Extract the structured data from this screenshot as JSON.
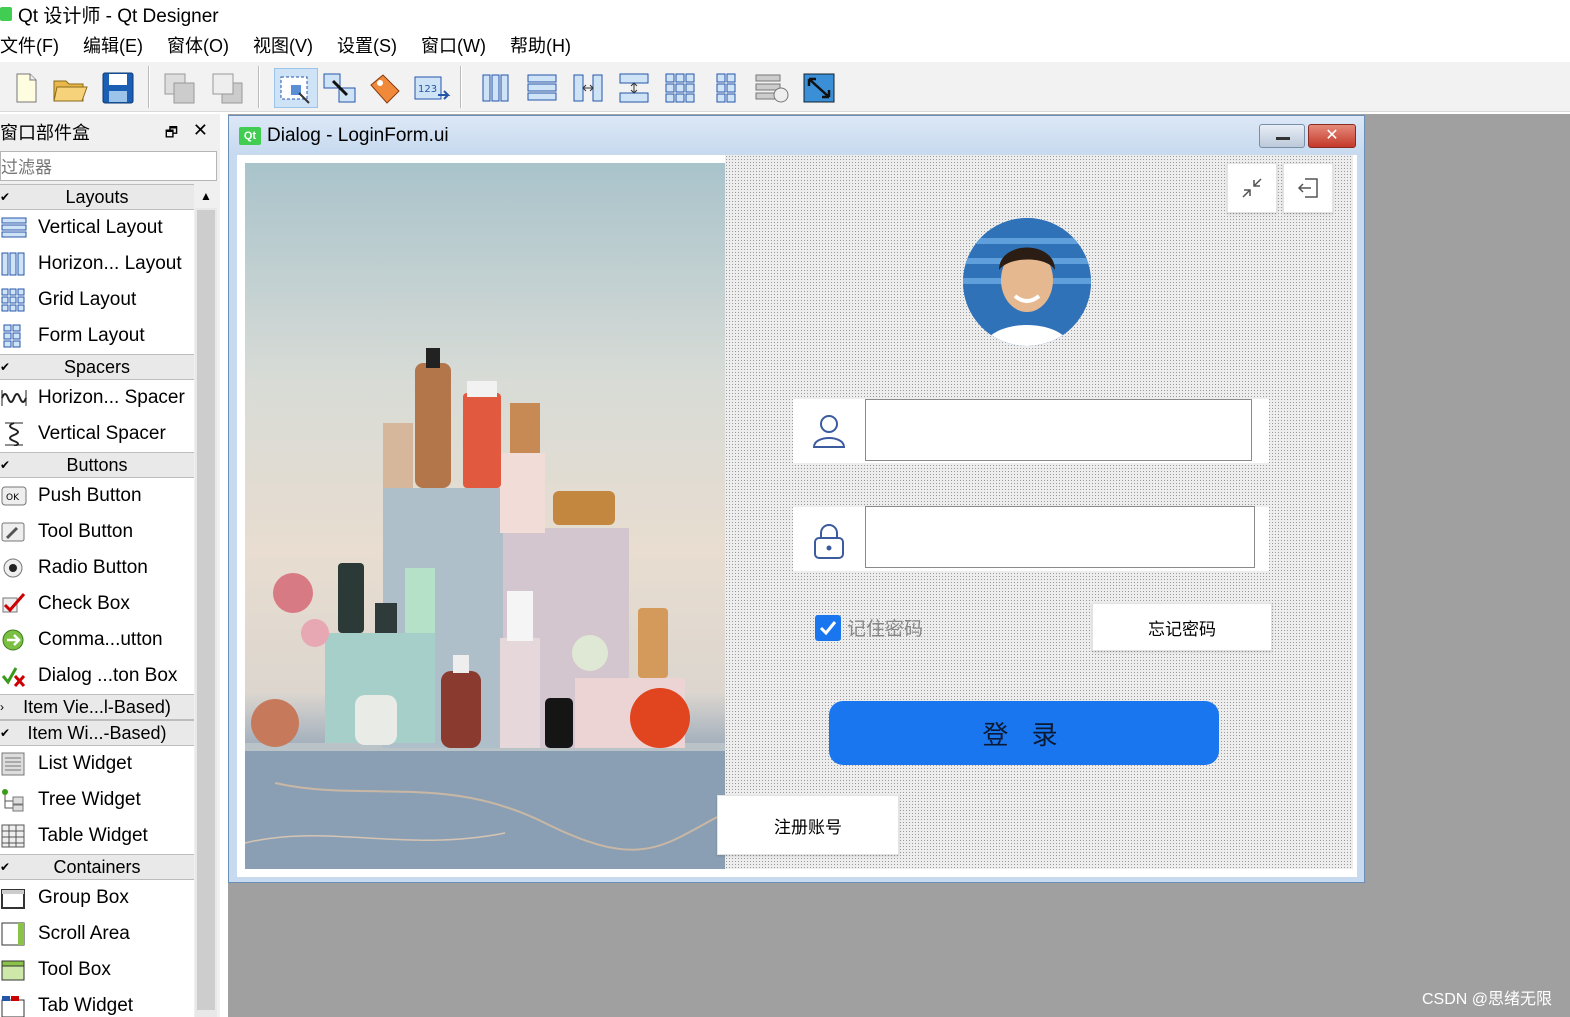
{
  "app": {
    "window_title": "Qt 设计师 - Qt Designer"
  },
  "menubar": {
    "items": [
      "文件(F)",
      "编辑(E)",
      "窗体(O)",
      "视图(V)",
      "设置(S)",
      "窗口(W)",
      "帮助(H)"
    ]
  },
  "toolbar": {
    "buttons": [
      {
        "name": "new-form-icon"
      },
      {
        "name": "open-form-icon"
      },
      {
        "name": "save-form-icon"
      },
      {
        "name": "send-to-back-icon"
      },
      {
        "name": "bring-to-front-icon"
      },
      {
        "name": "edit-widgets-icon"
      },
      {
        "name": "edit-signals-slots-icon"
      },
      {
        "name": "edit-buddies-icon"
      },
      {
        "name": "edit-tab-order-icon"
      },
      {
        "name": "layout-horizontal-icon"
      },
      {
        "name": "layout-vertical-icon"
      },
      {
        "name": "layout-h-splitter-icon"
      },
      {
        "name": "layout-v-splitter-icon"
      },
      {
        "name": "layout-grid-icon"
      },
      {
        "name": "layout-form-icon"
      },
      {
        "name": "break-layout-icon"
      },
      {
        "name": "adjust-size-icon"
      }
    ]
  },
  "widget_box": {
    "title": "窗口部件盒",
    "filter_placeholder": "过滤器",
    "categories": [
      {
        "label": "Layouts",
        "items": [
          "Vertical Layout",
          "Horizon... Layout",
          "Grid Layout",
          "Form Layout"
        ]
      },
      {
        "label": "Spacers",
        "items": [
          "Horizon... Spacer",
          "Vertical Spacer"
        ]
      },
      {
        "label": "Buttons",
        "items": [
          "Push Button",
          "Tool Button",
          "Radio Button",
          "Check Box",
          "Comma...utton",
          "Dialog ...ton Box"
        ]
      },
      {
        "label": "Item Vie...l-Based)",
        "items": []
      },
      {
        "label": "Item Wi...-Based)",
        "items": [
          "List Widget",
          "Tree Widget",
          "Table Widget"
        ]
      },
      {
        "label": "Containers",
        "items": [
          "Group Box",
          "Scroll Area",
          "Tool Box",
          "Tab Widget"
        ]
      }
    ]
  },
  "form_window": {
    "title": "Dialog - LoginForm.ui",
    "qt_badge": "Qt",
    "login_form": {
      "username_value": "",
      "password_value": "",
      "remember_label": "记住密码",
      "remember_checked": true,
      "forgot_label": "忘记密码",
      "login_label": "登 录",
      "register_label": "注册账号",
      "accent_color": "#1a76ef"
    }
  },
  "watermark": "CSDN @思绪无限"
}
